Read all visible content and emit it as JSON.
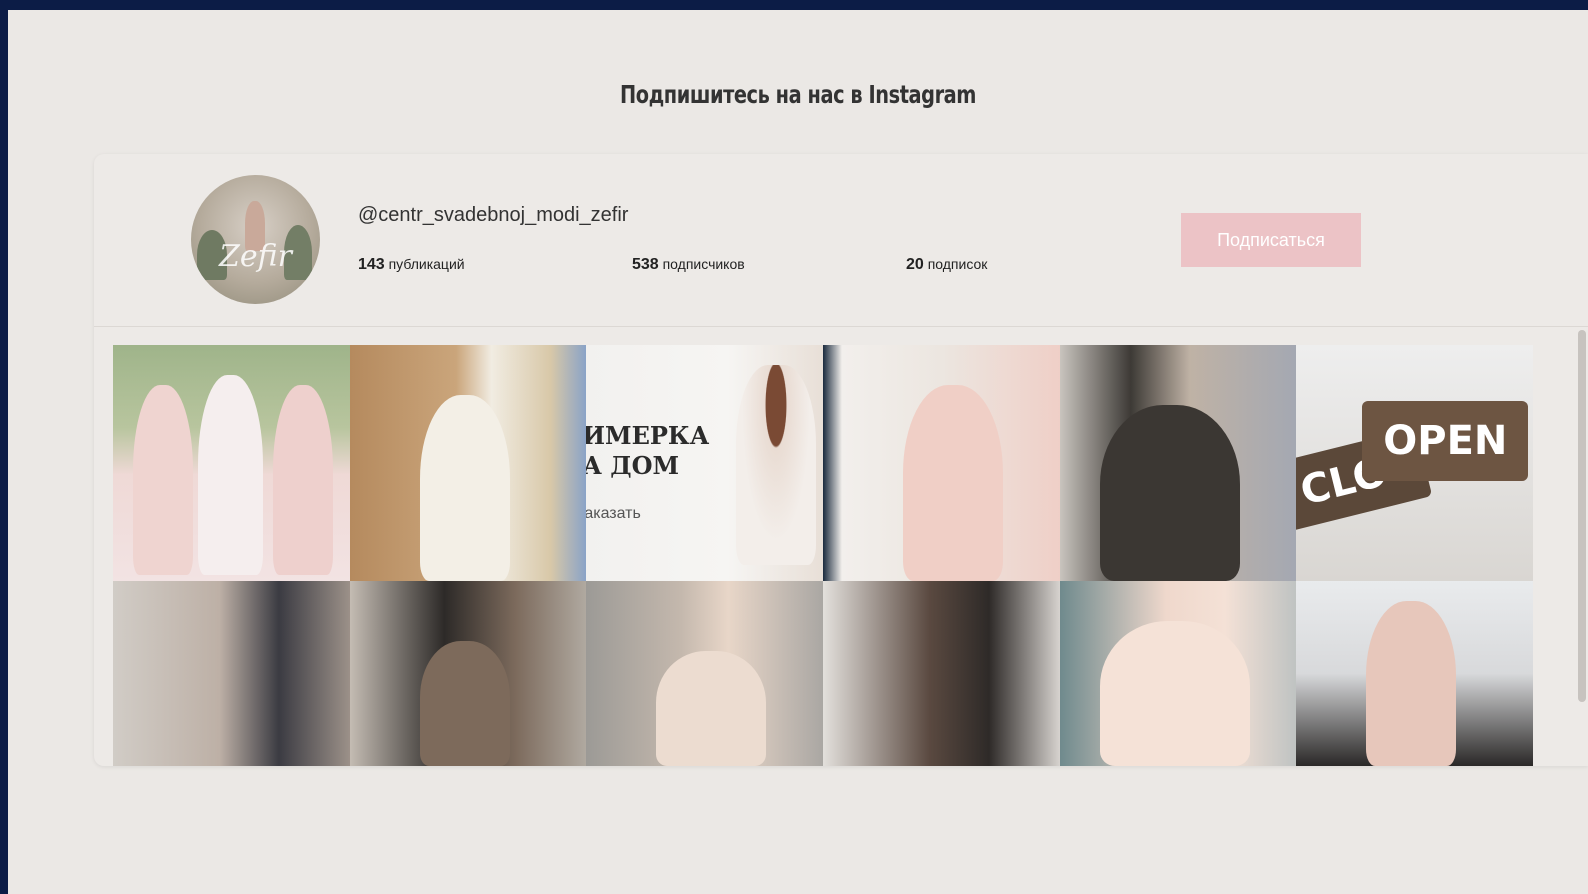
{
  "section": {
    "title": "Подпишитесь на нас в Instagram"
  },
  "profile": {
    "username": "@centr_svadebnoj_modi_zefir",
    "avatar_logo": "Zefir",
    "stats": {
      "posts_count": "143",
      "posts_label": "публикаций",
      "followers_count": "538",
      "followers_label": "подписчиков",
      "following_count": "20",
      "following_label": "подписок"
    },
    "subscribe_label": "Подписаться"
  },
  "colors": {
    "page_bg": "#ebe8e5",
    "frame_bg": "#0c1c46",
    "subscribe_button": "#ecc3c6"
  },
  "grid": {
    "tiles": [
      {
        "id": "post-1",
        "subject": "bridesmaids-with-bouquets"
      },
      {
        "id": "post-2",
        "subject": "white-dress-stone-wall"
      },
      {
        "id": "post-3",
        "subject": "fitting-at-home-promo",
        "text_line1": "ИМЕРКА",
        "text_line2": "А ДОМ",
        "text_line3": "аказать"
      },
      {
        "id": "post-4",
        "subject": "pink-dress-window"
      },
      {
        "id": "post-5",
        "subject": "black-embroidered-dress"
      },
      {
        "id": "post-6",
        "subject": "open-closed-sign",
        "sign_open": "OPEN",
        "sign_closed": "CLO"
      },
      {
        "id": "post-7",
        "subject": "grey-tulle-skirt"
      },
      {
        "id": "post-8",
        "subject": "black-lace-top-dress"
      },
      {
        "id": "post-9",
        "subject": "nude-dress-concrete-wall"
      },
      {
        "id": "post-10",
        "subject": "brown-tulle-dress"
      },
      {
        "id": "post-11",
        "subject": "peach-flowing-dress"
      },
      {
        "id": "post-12",
        "subject": "black-cape-portrait"
      }
    ]
  }
}
